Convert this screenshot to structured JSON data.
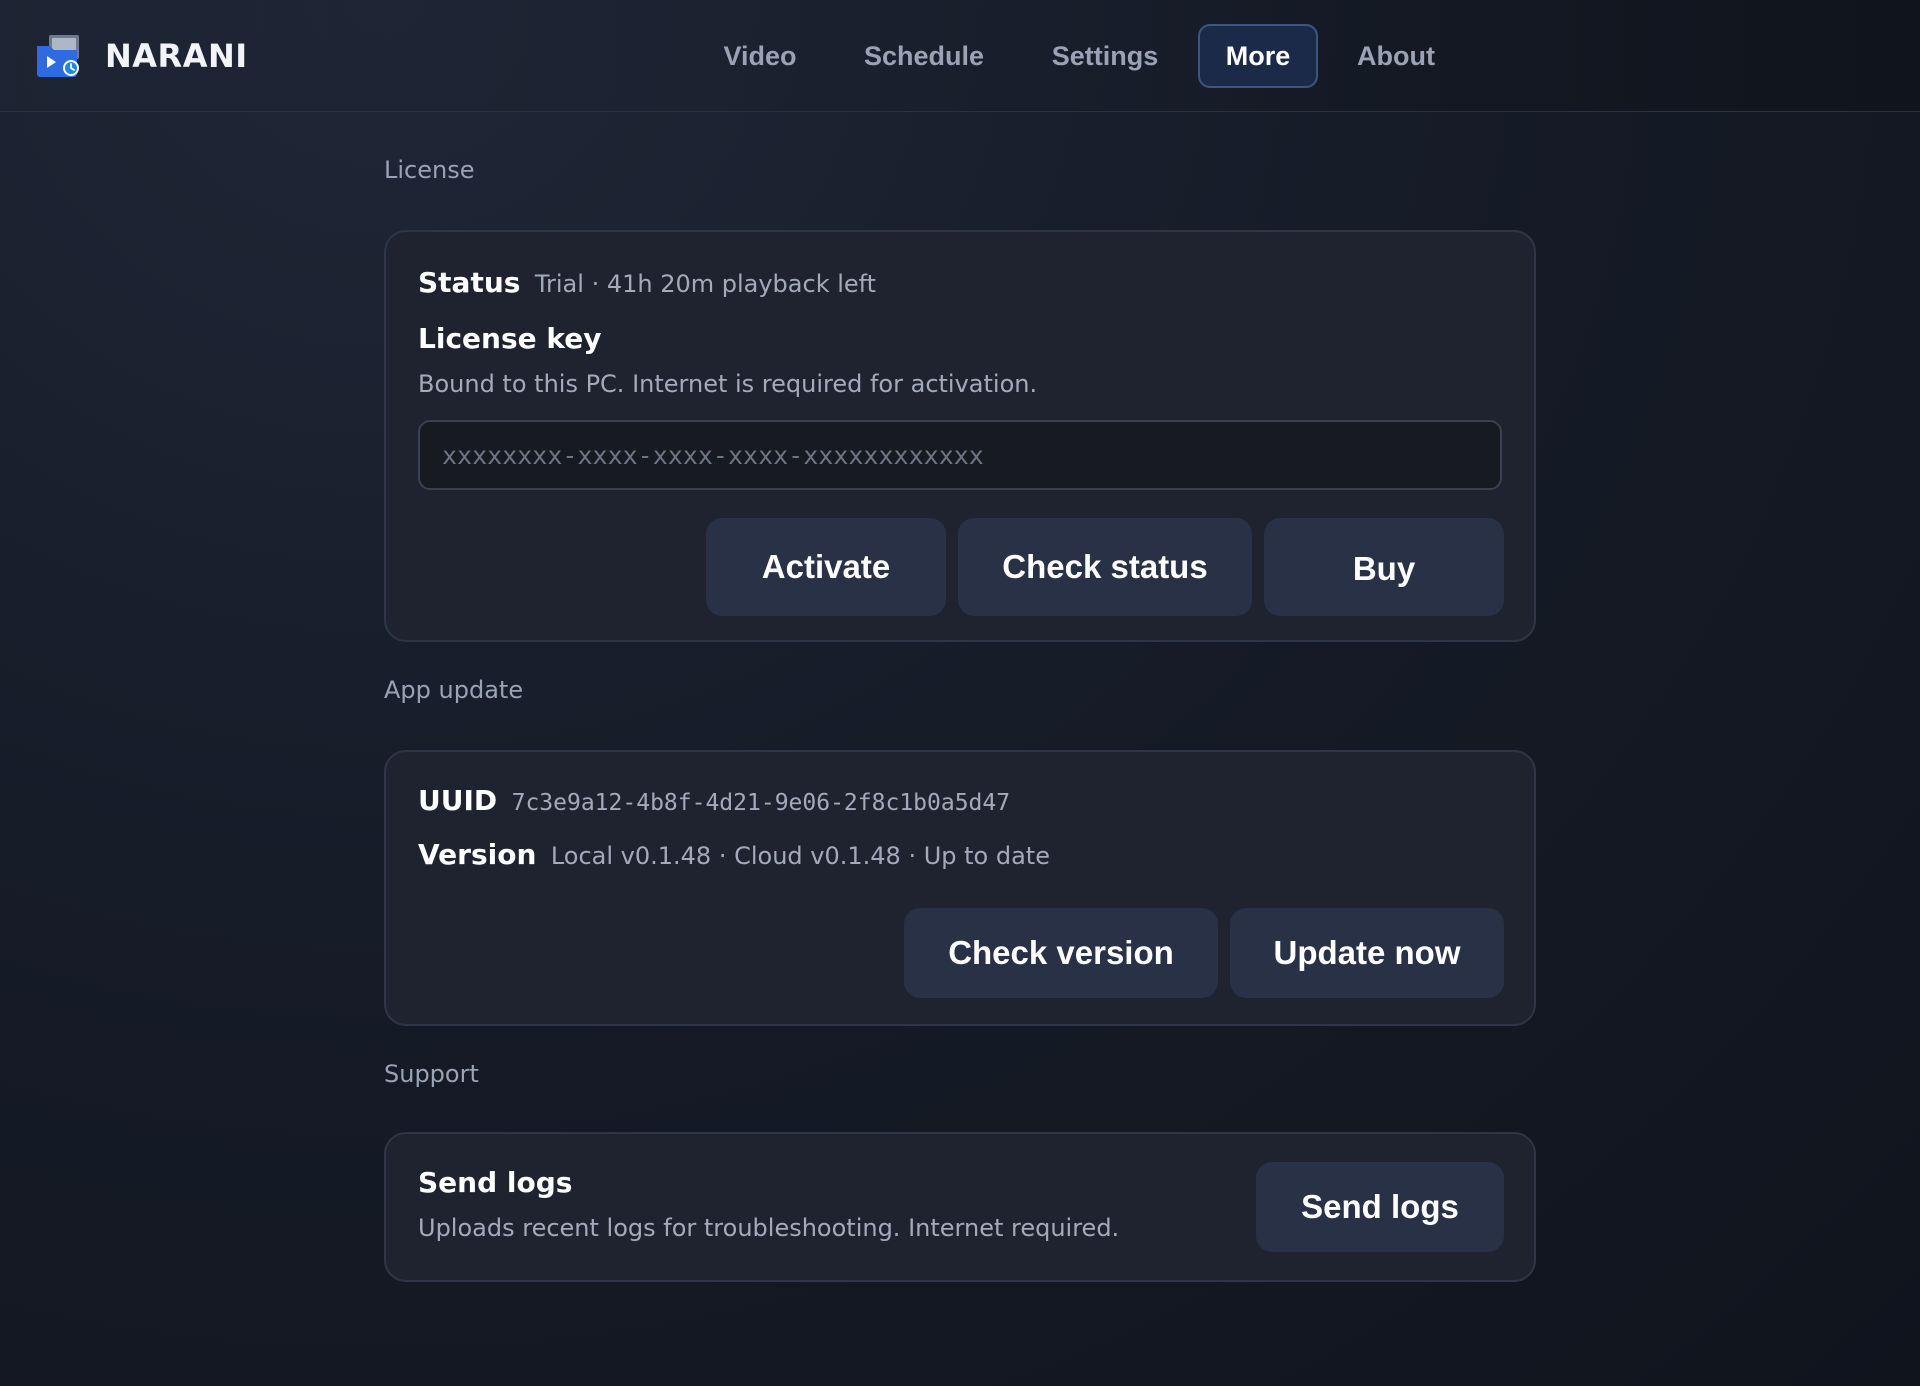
{
  "app": {
    "name": "NARANI",
    "logo_icon": "video-folder-icon"
  },
  "nav": {
    "items": [
      {
        "label": "Video"
      },
      {
        "label": "Schedule"
      },
      {
        "label": "Settings"
      },
      {
        "label": "More",
        "active": true
      },
      {
        "label": "About"
      }
    ]
  },
  "license": {
    "section_title": "License",
    "status_label": "Status",
    "status_value": "Trial · 41h 20m playback left",
    "key_label": "License key",
    "key_help": "Bound to this PC. Internet is required for activation.",
    "key_value": "",
    "key_placeholder": "xxxxxxxx-xxxx-xxxx-xxxx-xxxxxxxxxxxx",
    "activate_label": "Activate",
    "check_status_label": "Check status",
    "buy_label": "Buy"
  },
  "update": {
    "section_title": "App update",
    "uuid_label": "UUID",
    "uuid_value": "7c3e9a12-4b8f-4d21-9e06-2f8c1b0a5d47",
    "version_label": "Version",
    "version_value": "Local v0.1.48 · Cloud v0.1.48 · Up to date",
    "check_version_label": "Check version",
    "update_now_label": "Update now"
  },
  "support": {
    "section_title": "Support",
    "send_logs_title": "Send logs",
    "send_logs_desc": "Uploads recent logs for troubleshooting. Internet required.",
    "send_logs_button": "Send logs"
  },
  "colors": {
    "background": "#161c28",
    "card": "#1e232f",
    "button": "#283146",
    "nav_active_bg": "#1b2a48",
    "nav_active_border": "#3b5685",
    "accent_blue": "#2f6be0"
  }
}
